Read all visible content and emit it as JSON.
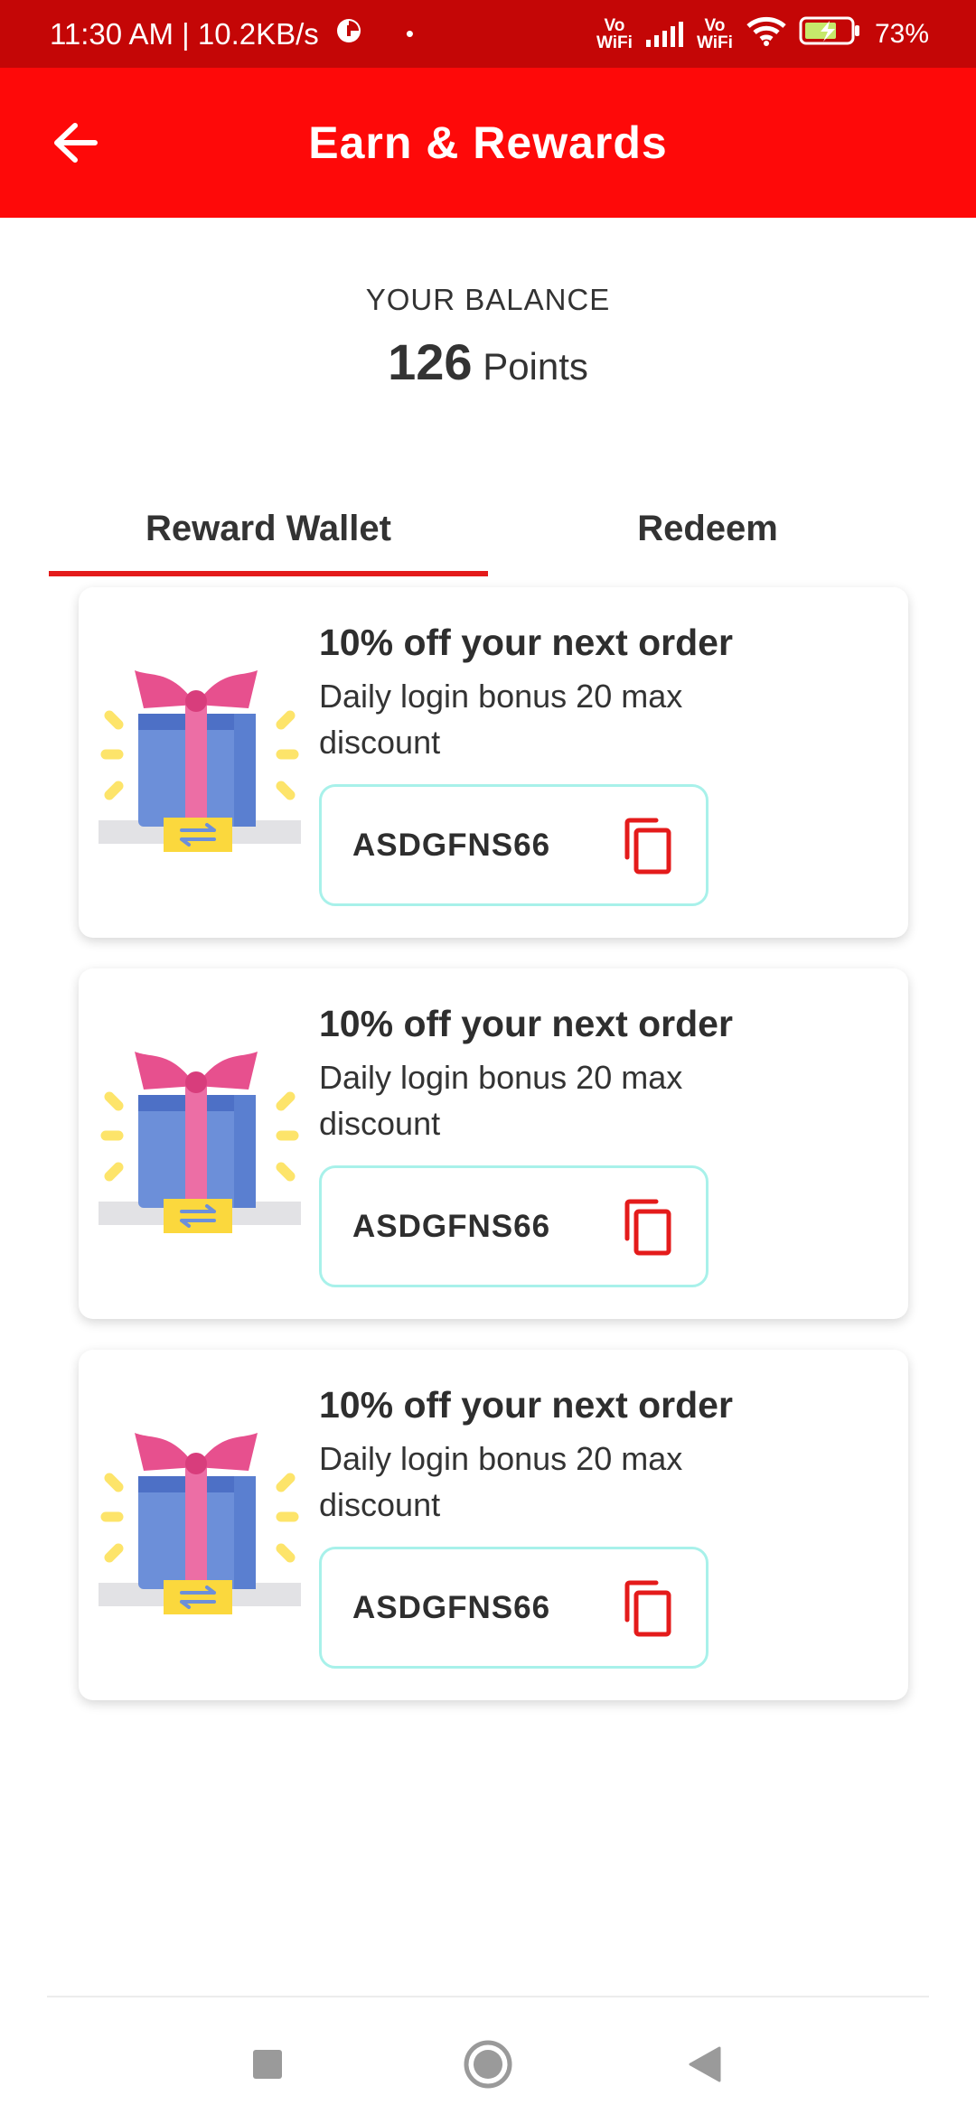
{
  "status_bar": {
    "time_speed": "11:30 AM | 10.2KB/s",
    "vowifi_1": "Vo WiFi",
    "vowifi_2": "Vo WiFi",
    "battery": "73%"
  },
  "app_bar": {
    "title": "Earn & Rewards",
    "back_icon": "arrow-left-icon"
  },
  "balance": {
    "label": "YOUR BALANCE",
    "points": "126",
    "unit": "Points"
  },
  "tabs": [
    {
      "label": "Reward Wallet",
      "active": true
    },
    {
      "label": "Redeem",
      "active": false
    }
  ],
  "rewards": [
    {
      "title": "10% off your next order",
      "description": "Daily login bonus 20 max discount",
      "code": "ASDGFNS66",
      "icon": "gift-icon"
    },
    {
      "title": "10% off your next order",
      "description": "Daily login bonus 20 max discount",
      "code": "ASDGFNS66",
      "icon": "gift-icon"
    },
    {
      "title": "10% off your next order",
      "description": "Daily login bonus 20 max discount",
      "code": "ASDGFNS66",
      "icon": "gift-icon"
    }
  ],
  "colors": {
    "status_bar": "#c40606",
    "app_bar": "#fe0909",
    "accent": "#e41b1b",
    "code_border": "#a8f1ea"
  }
}
